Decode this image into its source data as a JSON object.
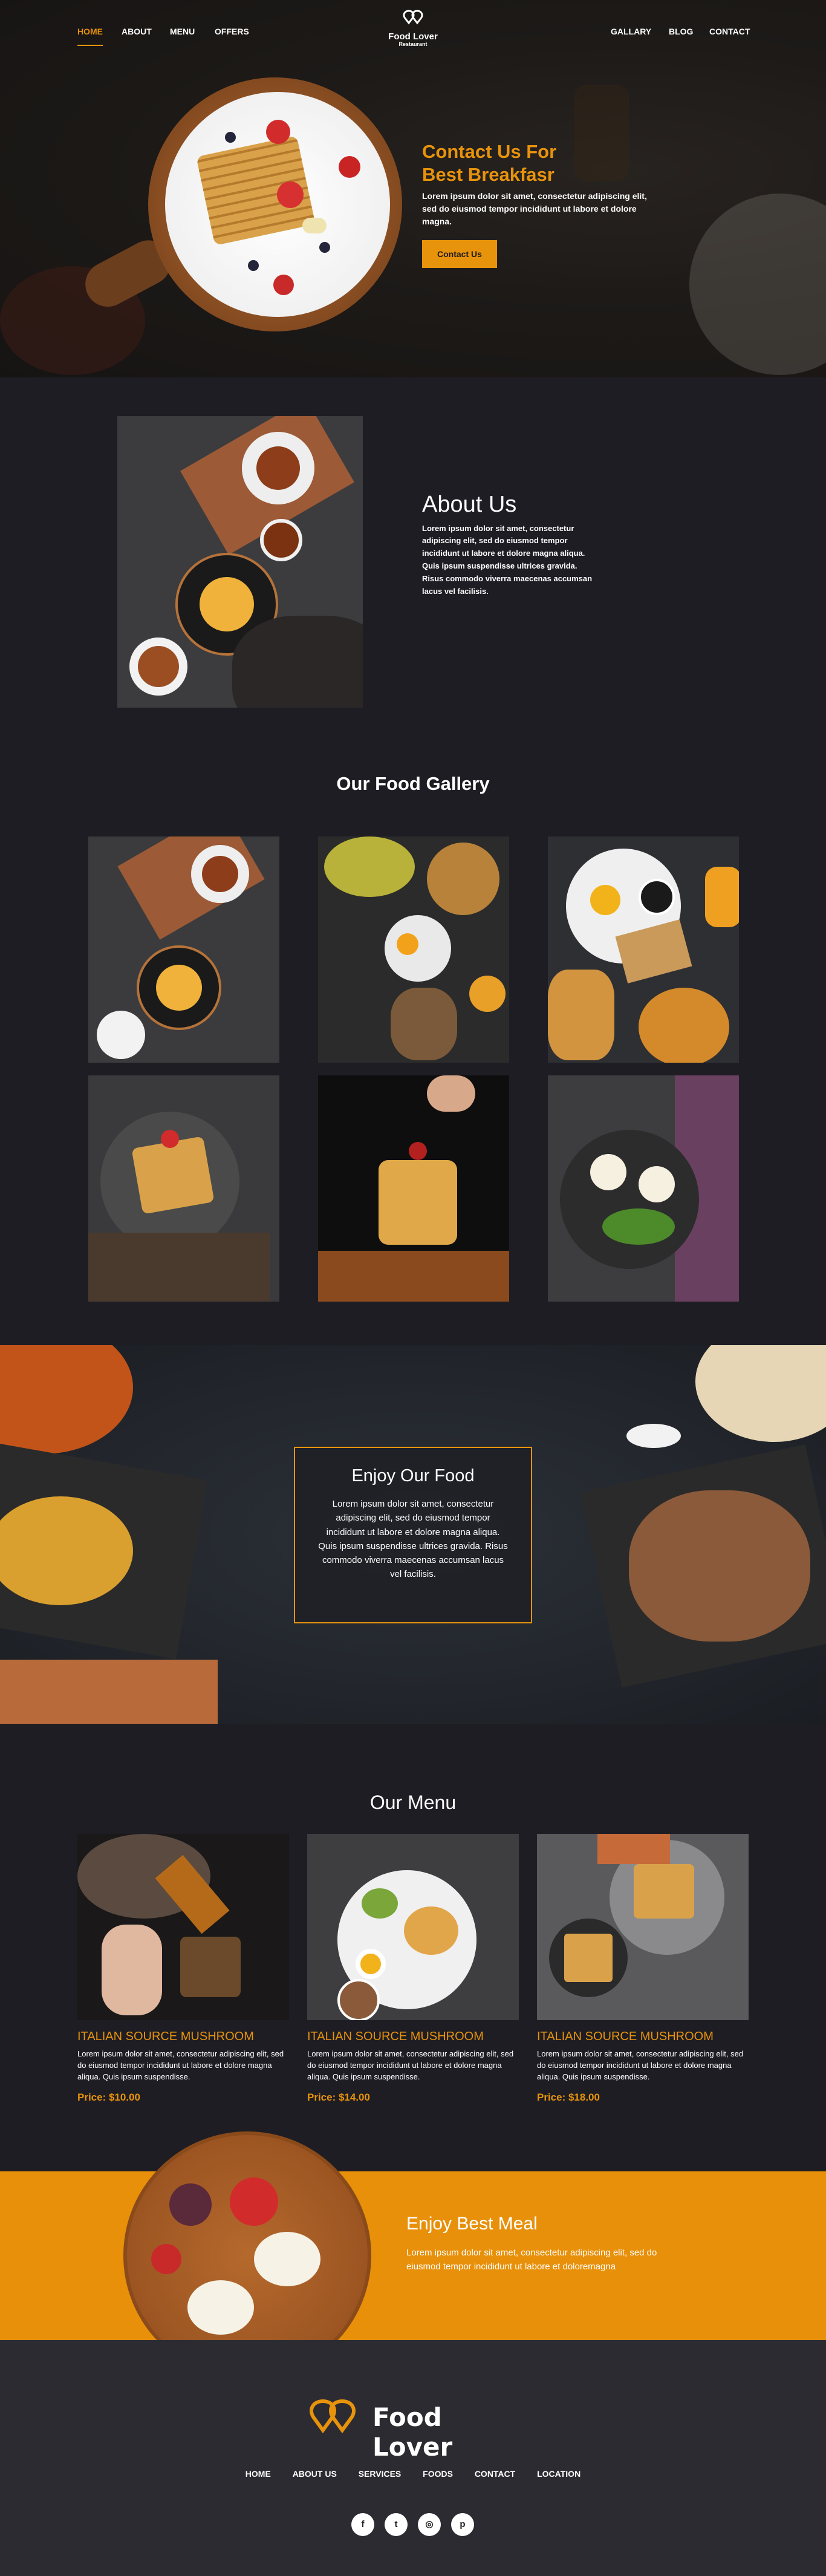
{
  "nav": {
    "left": [
      "HOME",
      "ABOUT",
      "MENU",
      "OFFERS"
    ],
    "right": [
      "GALLARY",
      "BLOG",
      "CONTACT"
    ],
    "logo_name": "Food Lover",
    "logo_sub": "Restaurant"
  },
  "hero": {
    "title_line1": "Contact Us For",
    "title_line2": "Best Breakfasr",
    "body": "Lorem ipsum dolor sit amet, consectetur adipiscing elit, sed do eiusmod tempor incididunt ut labore et dolore magna.",
    "button": "Contact Us"
  },
  "about": {
    "title": "About Us",
    "body": "Lorem ipsum dolor sit amet, consectetur adipiscing elit, sed do eiusmod tempor incididunt ut labore et dolore magna aliqua. Quis ipsum suspendisse ultrices gravida. Risus commodo viverra maecenas accumsan lacus vel facilisis."
  },
  "gallery": {
    "title": "Our Food Gallery"
  },
  "enjoy": {
    "title": "Enjoy Our Food",
    "body": "Lorem ipsum dolor sit amet, consectetur adipiscing elit, sed do eiusmod tempor incididunt ut labore et dolore magna aliqua. Quis ipsum suspendisse ultrices gravida. Risus commodo viverra maecenas accumsan lacus vel facilisis."
  },
  "menu": {
    "title": "Our Menu",
    "items": [
      {
        "name": "ITALIAN SOURCE MUSHROOM",
        "desc": "Lorem ipsum dolor sit amet, consectetur adipiscing elit, sed do eiusmod tempor incididunt ut labore et dolore magna aliqua. Quis ipsum suspendisse.",
        "price": "Price: $10.00"
      },
      {
        "name": "ITALIAN SOURCE MUSHROOM",
        "desc": "Lorem ipsum dolor sit amet, consectetur adipiscing elit, sed do eiusmod tempor incididunt ut labore et dolore magna aliqua. Quis ipsum suspendisse.",
        "price": "Price: $14.00"
      },
      {
        "name": "ITALIAN SOURCE MUSHROOM",
        "desc": "Lorem ipsum dolor sit amet, consectetur adipiscing elit, sed do eiusmod tempor incididunt ut labore et dolore magna aliqua. Quis ipsum suspendisse.",
        "price": "Price: $18.00"
      }
    ]
  },
  "best": {
    "title": "Enjoy Best Meal",
    "body": "Lorem ipsum dolor sit amet, consectetur adipiscing elit, sed do eiusmod tempor incididunt ut labore et doloremagna"
  },
  "footer": {
    "logo_name": "Food Lover",
    "nav": [
      "HOME",
      "ABOUT US",
      "SERVICES",
      "FOODS",
      "CONTACT",
      "LOCATION"
    ],
    "social": [
      {
        "icon": "facebook-icon",
        "glyph": "f"
      },
      {
        "icon": "twitter-icon",
        "glyph": "t"
      },
      {
        "icon": "instagram-icon",
        "glyph": "◎"
      },
      {
        "icon": "pinterest-icon",
        "glyph": "p"
      }
    ]
  },
  "colors": {
    "accent": "#e8930c",
    "background": "#1e1d24",
    "footer": "#2c2b31",
    "band": "#e89009"
  }
}
